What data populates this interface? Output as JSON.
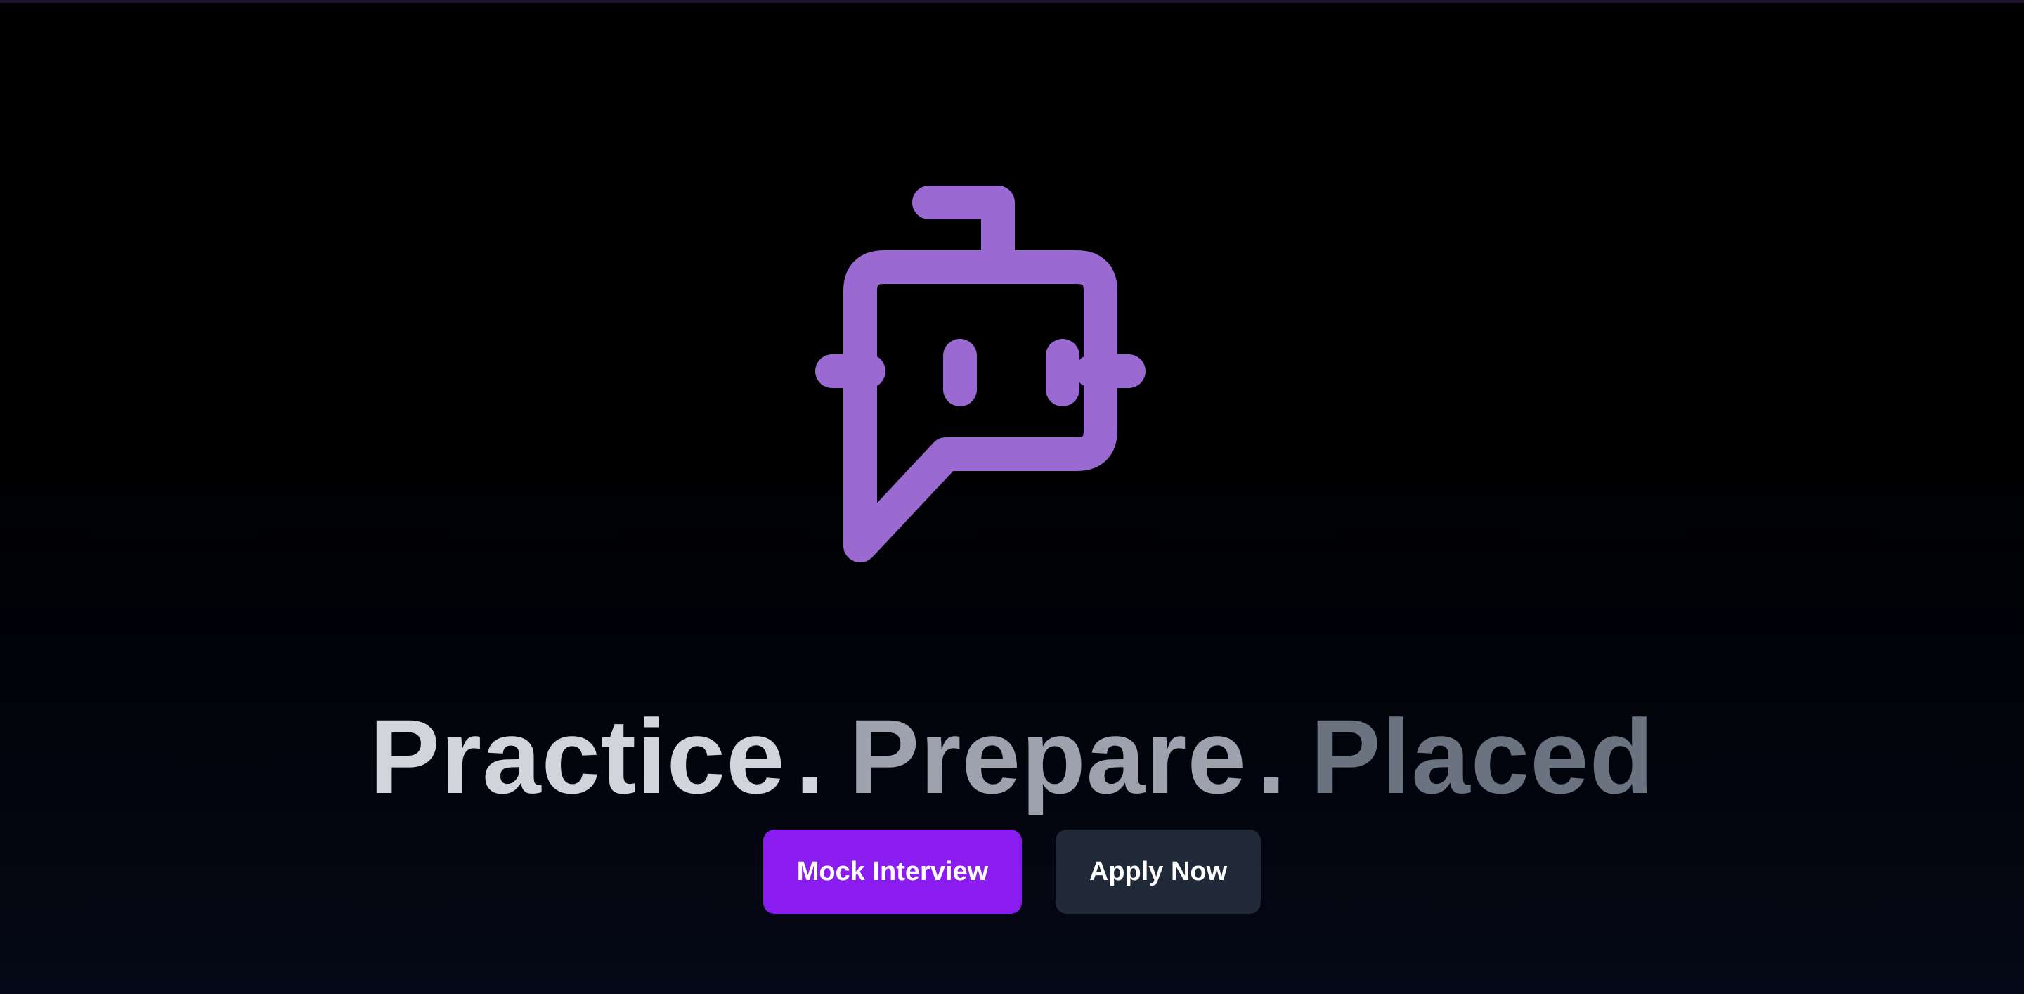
{
  "hero": {
    "logo_icon": "robot-chat-bubble-icon",
    "headline": {
      "word1": "Practice",
      "sep1": ".",
      "word2": "Prepare",
      "sep2": ".",
      "word3": "Placed"
    },
    "buttons": {
      "primary_label": "Mock Interview",
      "secondary_label": "Apply Now"
    }
  },
  "colors": {
    "accent": "#8b1cf0",
    "logo": "#a66ee8",
    "secondary_button": "#1f2937",
    "headline_1": "#d1d5db",
    "headline_2": "#9ca3af",
    "headline_3": "#6b7280"
  }
}
